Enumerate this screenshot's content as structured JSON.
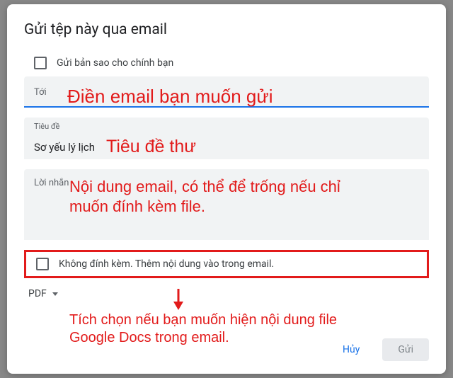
{
  "dialog": {
    "title": "Gửi tệp này qua email",
    "send_copy_label": "Gửi bản sao cho chính bạn",
    "to_label": "Tới",
    "subject_label": "Tiêu đề",
    "subject_value": "Sơ yếu lý lịch",
    "message_label": "Lời nhắn",
    "no_attach_label": "Không đính kèm. Thêm nội dung vào trong email.",
    "format_label": "PDF",
    "cancel_label": "Hủy",
    "send_label": "Gửi"
  },
  "annotations": {
    "to_hint": "Điền email bạn muốn gửi",
    "subject_hint": "Tiêu đề thư",
    "message_hint": "Nội dung email, có thể để trống nếu chỉ muốn đính kèm file.",
    "attach_hint": "Tích chọn nếu bạn muốn hiện nội dung file Google Docs trong email."
  },
  "colors": {
    "accent": "#1a73e8",
    "annotation": "#e21b1b"
  }
}
